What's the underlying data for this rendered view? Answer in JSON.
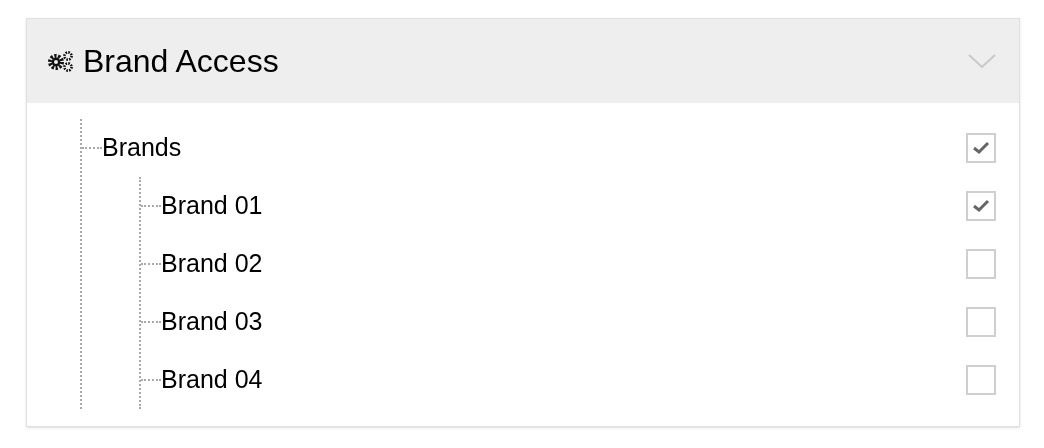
{
  "panel": {
    "title": "Brand Access"
  },
  "tree": [
    {
      "label": "Brands",
      "checked": true,
      "children": [
        {
          "label": "Brand 01",
          "checked": true
        },
        {
          "label": "Brand 02",
          "checked": false
        },
        {
          "label": "Brand 03",
          "checked": false
        },
        {
          "label": "Brand 04",
          "checked": false
        }
      ]
    }
  ]
}
